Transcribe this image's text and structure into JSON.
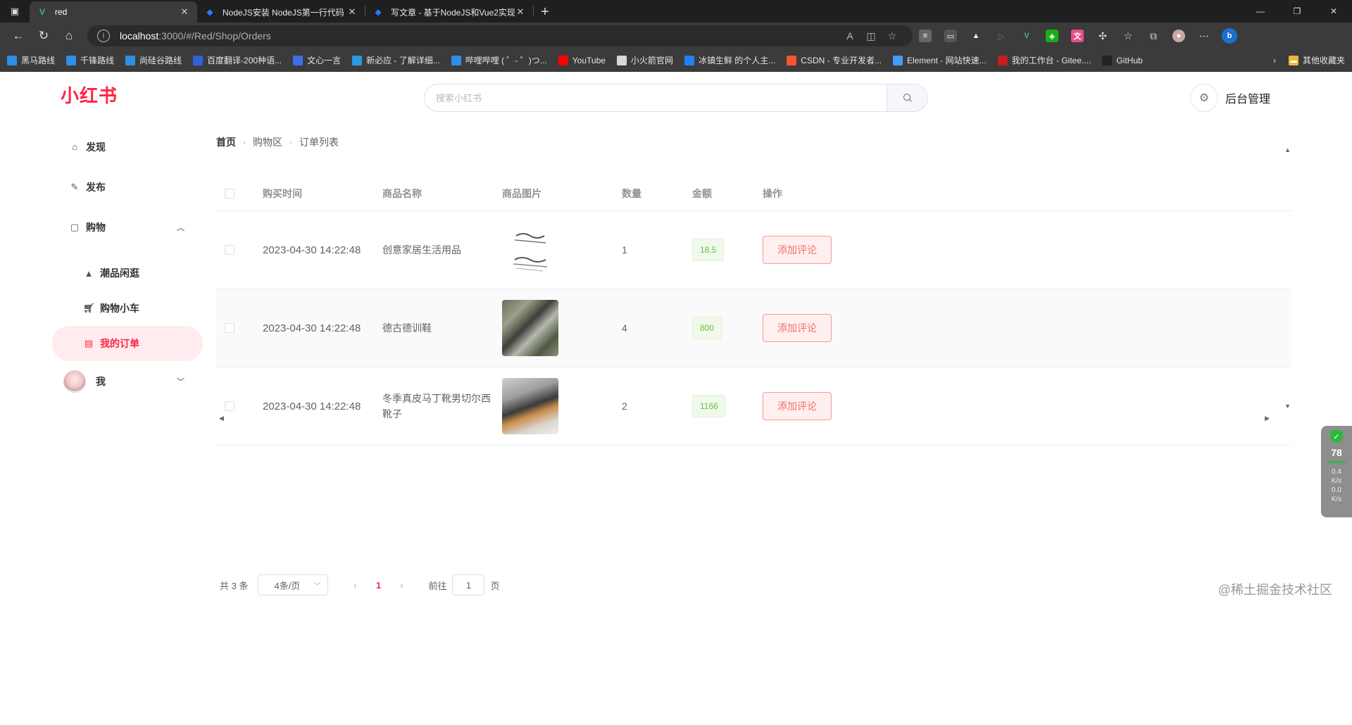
{
  "browser": {
    "tabs": [
      {
        "title": "red",
        "icon": "vue-logo",
        "color": "#41b883",
        "active": true
      },
      {
        "title": "NodeJS安装 NodeJS第一行代码",
        "icon": "juejin-logo",
        "color": "#1e80ff",
        "active": false
      },
      {
        "title": "写文章 - 基于NodeJS和Vue2实现",
        "icon": "juejin-logo",
        "color": "#1e80ff",
        "active": false
      }
    ],
    "url_host": "localhost",
    "url_path": ":3000/#/Red/Shop/Orders",
    "bookmarks": [
      {
        "label": "黑马路线",
        "color": "#2f8ee5"
      },
      {
        "label": "千锋路线",
        "color": "#2f8ee5"
      },
      {
        "label": "尚硅谷路线",
        "color": "#2f8ee5"
      },
      {
        "label": "百度翻译-200种语...",
        "color": "#2e64d8"
      },
      {
        "label": "文心一言",
        "color": "#3d6fe8"
      },
      {
        "label": "新必应 - 了解详细...",
        "color": "#2b9be0"
      },
      {
        "label": "哔哩哔哩 ( ゜- ゜)つ...",
        "color": "#2f8ee5"
      },
      {
        "label": "YouTube",
        "color": "#ff0000"
      },
      {
        "label": "小火箭官网",
        "color": "#d8d8d8"
      },
      {
        "label": "冰镇生鲜 的个人主...",
        "color": "#1e80ff"
      },
      {
        "label": "CSDN - 专业开发者...",
        "color": "#fc5531"
      },
      {
        "label": "Element - 网站快速...",
        "color": "#409eff"
      },
      {
        "label": "我的工作台 - Gitee....",
        "color": "#c71d23"
      },
      {
        "label": "GitHub",
        "color": "#222222"
      }
    ],
    "other_bookmarks": "其他收藏夹"
  },
  "header": {
    "logo": "小红书",
    "search_placeholder": "搜索小红书",
    "admin_label": "后台管理"
  },
  "sidebar": {
    "items": [
      {
        "label": "发现",
        "icon": "discover-icon"
      },
      {
        "label": "发布",
        "icon": "edit-icon"
      },
      {
        "label": "购物",
        "icon": "bag-icon"
      }
    ],
    "sub_items": [
      {
        "label": "潮品闲逛",
        "icon": "shopping-bag-icon"
      },
      {
        "label": "购物小车",
        "icon": "cart-icon"
      },
      {
        "label": "我的订单",
        "icon": "document-icon",
        "active": true
      }
    ],
    "me_label": "我"
  },
  "breadcrumb": [
    "首页",
    "购物区",
    "订单列表"
  ],
  "table": {
    "columns": [
      "购买时间",
      "商品名称",
      "商品图片",
      "数量",
      "金额",
      "操作"
    ],
    "rows": [
      {
        "time": "2023-04-30 14:22:48",
        "name": "创意家居生活用品",
        "quantity": "1",
        "amount": "18.5",
        "action": "添加评论"
      },
      {
        "time": "2023-04-30 14:22:48",
        "name": "德古德训鞋",
        "quantity": "4",
        "amount": "800",
        "action": "添加评论"
      },
      {
        "time": "2023-04-30 14:22:48",
        "name": "冬季真皮马丁靴男切尔西靴子",
        "quantity": "2",
        "amount": "1166",
        "action": "添加评论"
      }
    ]
  },
  "pagination": {
    "total": "共 3 条",
    "page_size": "4条/页",
    "current_page": "1",
    "goto_label": "前往",
    "goto_value": "1",
    "page_unit": "页"
  },
  "widget": {
    "percent": "78",
    "up": "0.4",
    "down": "0.0",
    "unit": "K/s"
  },
  "watermark": "@稀土掘金技术社区",
  "colors": {
    "brand": "#ff2442",
    "amount_green": "#67c23a",
    "danger": "#f56c6c"
  }
}
